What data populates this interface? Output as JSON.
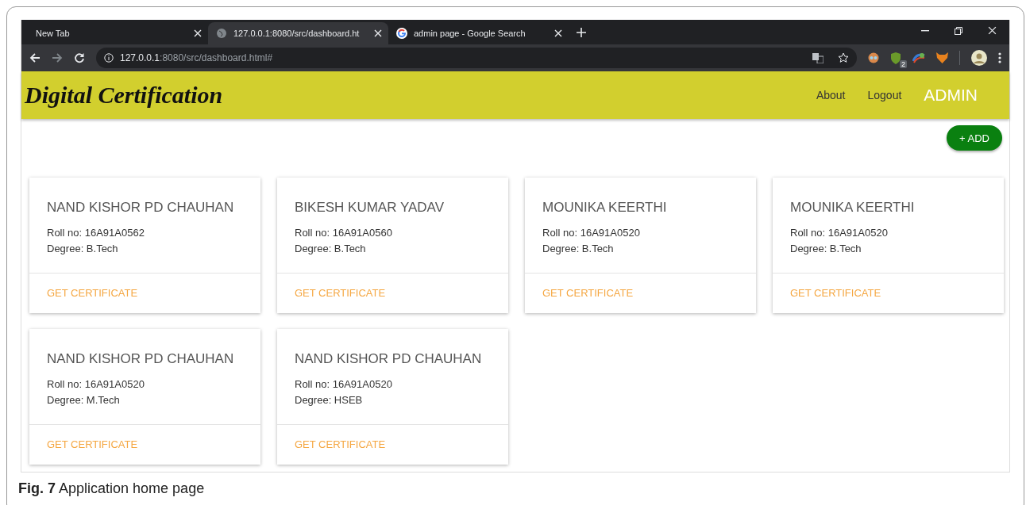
{
  "browser": {
    "tabs": [
      {
        "title": "New Tab",
        "kind": "plain",
        "selected": false
      },
      {
        "title": "127.0.0.1:8080/src/dashboard.ht",
        "kind": "site",
        "selected": true
      },
      {
        "title": "admin page - Google Search",
        "kind": "search",
        "selected": false
      }
    ],
    "address": {
      "host": "127.0.0.1",
      "path": ":8080/src/dashboard.html#"
    },
    "extension_badge": "2"
  },
  "header": {
    "title": "Digital Certification",
    "nav": [
      "About",
      "Logout"
    ],
    "user": "ADMIN"
  },
  "add_button": "+ ADD",
  "cards": [
    {
      "name": "NAND KISHOR PD CHAUHAN",
      "roll": "Roll no: 16A91A0562",
      "degree": "Degree: B.Tech",
      "action": "GET CERTIFICATE"
    },
    {
      "name": "BIKESH KUMAR YADAV",
      "roll": "Roll no: 16A91A0560",
      "degree": "Degree: B.Tech",
      "action": "GET CERTIFICATE"
    },
    {
      "name": "MOUNIKA KEERTHI",
      "roll": "Roll no: 16A91A0520",
      "degree": "Degree: B.Tech",
      "action": "GET CERTIFICATE"
    },
    {
      "name": "MOUNIKA KEERTHI",
      "roll": "Roll no: 16A91A0520",
      "degree": "Degree: B.Tech",
      "action": "GET CERTIFICATE"
    },
    {
      "name": "NAND KISHOR PD CHAUHAN",
      "roll": "Roll no: 16A91A0520",
      "degree": "Degree: M.Tech",
      "action": "GET CERTIFICATE"
    },
    {
      "name": "NAND KISHOR PD CHAUHAN",
      "roll": "Roll no: 16A91A0520",
      "degree": "Degree: HSEB",
      "action": "GET CERTIFICATE"
    }
  ],
  "caption": "**Fig. 7** Application home page"
}
